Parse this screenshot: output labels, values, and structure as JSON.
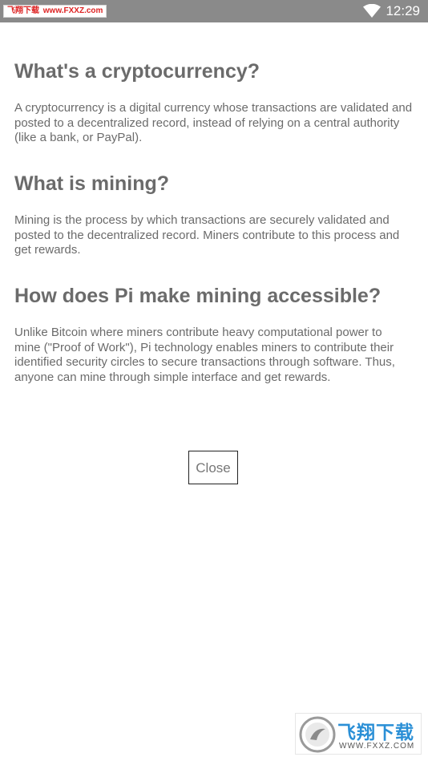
{
  "status_bar": {
    "watermark_text": "飞翔下载",
    "watermark_url": "www.FXXZ.com",
    "time": "12:29"
  },
  "sections": [
    {
      "heading": "What's a cryptocurrency?",
      "body": "A cryptocurrency is a digital currency whose transactions are validated and posted to a decentralized record, instead of relying on a central authority (like a bank, or PayPal)."
    },
    {
      "heading": "What is mining?",
      "body": "Mining is the process by which transactions are securely validated and posted to the decentralized record. Miners contribute to this process and get rewards."
    },
    {
      "heading": "How does Pi make mining accessible?",
      "body": "Unlike Bitcoin where miners contribute heavy computational power to mine (\"Proof of Work\"), Pi technology enables miners to contribute their identified security circles to secure transactions through software. Thus, anyone can mine through simple interface and get rewards."
    }
  ],
  "close_label": "Close",
  "watermark_bottom": {
    "title": "飞翔下载",
    "url": "WWW.FXXZ.COM"
  },
  "colors": {
    "status_bar": "#8a8a8a",
    "text": "#6b6b6b",
    "watermark_blue": "#2a8fd6"
  }
}
